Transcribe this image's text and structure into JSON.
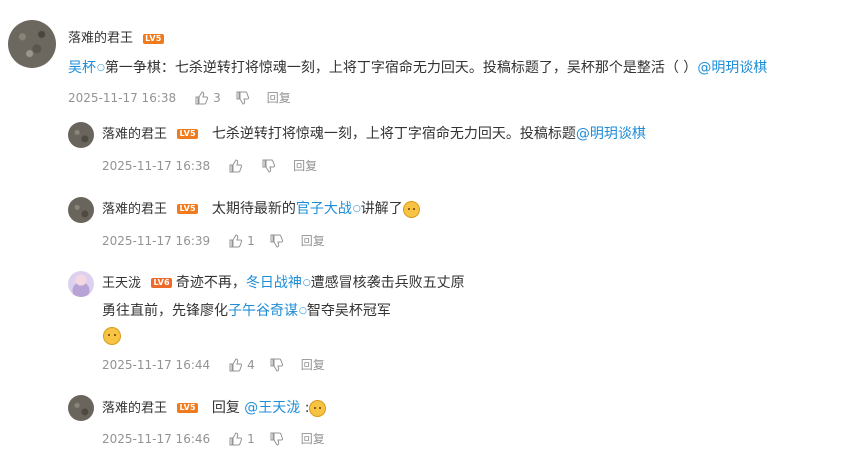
{
  "main_comment": {
    "user": "落难的君王",
    "level": "LV5",
    "parts": {
      "topic": "吴杯",
      "body": "第一争棋：七杀逆转打将惊魂一刻，上将丁字宿命无力回天。投稿标题了，吴杯那个是整活（ ）",
      "mention": "@明玥谈棋"
    },
    "time": "2025-11-17 16:38",
    "likes": "3",
    "reply_label": "回复"
  },
  "replies": [
    {
      "user": "落难的君王",
      "level": "LV5",
      "text": "七杀逆转打将惊魂一刻，上将丁字宿命无力回天。投稿标题",
      "mention": "@明玥谈棋",
      "time": "2025-11-17 16:38",
      "likes": "",
      "reply_label": "回复"
    },
    {
      "user": "落难的君王",
      "level": "LV5",
      "text_before": "太期待最新的",
      "topic": "官子大战",
      "text_after": "讲解了",
      "emoji": "cat-emoji",
      "time": "2025-11-17 16:39",
      "likes": "1",
      "reply_label": "回复"
    },
    {
      "user": "王天泷",
      "level": "LV6",
      "line1_before": "奇迹不再，",
      "topic1": "冬日战神",
      "line1_after": "遭感冒核袭击兵败五丈原",
      "line2_before": "勇往直前，先锋廖化",
      "topic2": "子午谷奇谋",
      "line2_after": "智夺吴杯冠军",
      "emoji": "doge-emoji",
      "time": "2025-11-17 16:44",
      "likes": "4",
      "reply_label": "回复"
    },
    {
      "user": "落难的君王",
      "level": "LV5",
      "reply_word": "回复",
      "mention": "@王天泷",
      "colon": ":",
      "emoji": "doge-emoji",
      "time": "2025-11-17 16:46",
      "likes": "1",
      "reply_label": "回复"
    }
  ],
  "colors": {
    "link": "#1d8dd8",
    "meta": "#939393",
    "level_badge": "#f07a1c"
  }
}
